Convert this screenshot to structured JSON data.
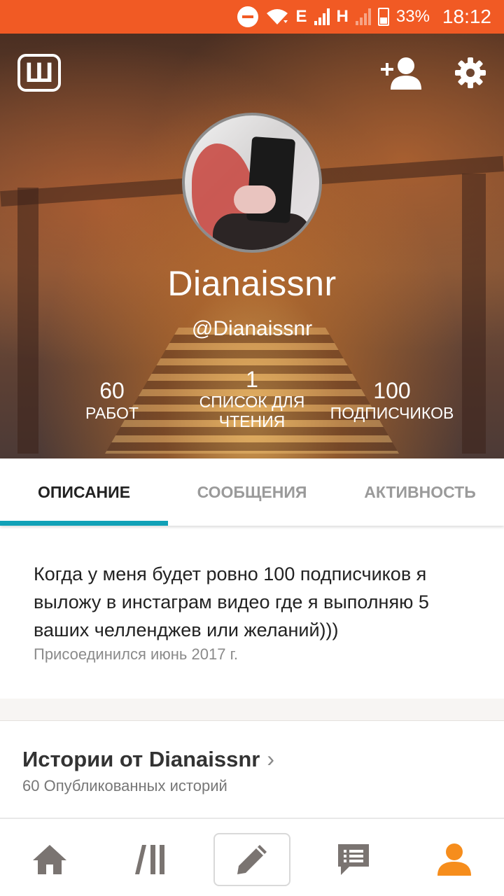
{
  "status_bar": {
    "network_1": "E",
    "network_2": "H",
    "battery": "33%",
    "time": "18:12"
  },
  "profile": {
    "logo_letter": "Ш",
    "username": "Dianaissnr",
    "handle": "@Dianaissnr",
    "stats": [
      {
        "number": "60",
        "label_line1": "РАБОТ",
        "label_line2": ""
      },
      {
        "number": "1",
        "label_line1": "СПИСОК ДЛЯ",
        "label_line2": "ЧТЕНИЯ"
      },
      {
        "number": "100",
        "label_line1": "ПОДПИСЧИКОВ",
        "label_line2": ""
      }
    ]
  },
  "tabs": [
    {
      "label": "ОПИСАНИЕ",
      "active": true
    },
    {
      "label": "СООБЩЕНИЯ",
      "active": false
    },
    {
      "label": "АКТИВНОСТЬ",
      "active": false
    }
  ],
  "about": {
    "description": "Когда у меня будет ровно 100 подписчиков я выложу в инстаграм видео где я выполняю 5 ваших челленджев или желаний)))",
    "joined": "Присоединился июнь 2017 г."
  },
  "stories": {
    "title": "Истории от Dianaissnr",
    "subtitle": "60 Опубликованных историй"
  },
  "bottom_nav": {
    "items": [
      "home-icon",
      "library-icon",
      "write-icon",
      "messages-icon",
      "profile-icon"
    ],
    "active": "profile-icon"
  },
  "colors": {
    "status_bar": "#f15a24",
    "tab_indicator": "#11a1b7",
    "nav_active": "#f68d1c",
    "nav_inactive": "#7a7471"
  }
}
